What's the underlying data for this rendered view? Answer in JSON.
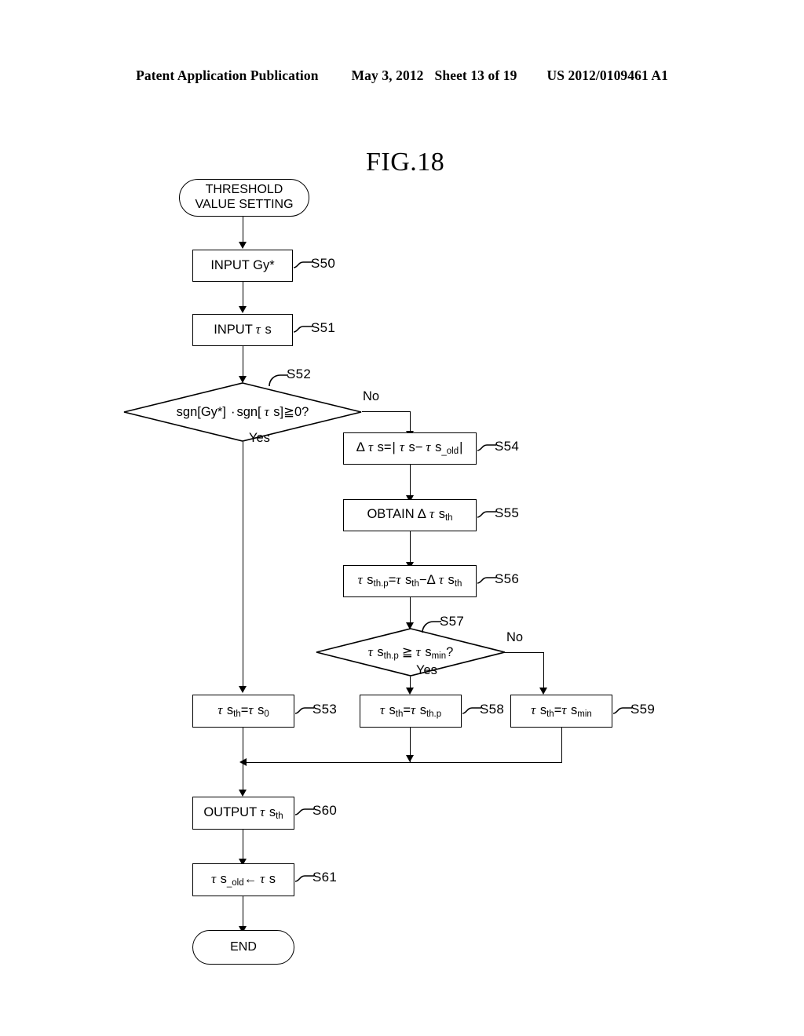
{
  "header": {
    "publication": "Patent Application Publication",
    "date": "May 3, 2012",
    "sheet": "Sheet 13 of 19",
    "docnum": "US 2012/0109461 A1"
  },
  "figure": {
    "title": "FIG.18"
  },
  "flowchart": {
    "type": "flowchart",
    "start": {
      "id": "start",
      "shape": "terminator",
      "line1": "THRESHOLD",
      "line2": "VALUE SETTING"
    },
    "end": {
      "id": "end",
      "shape": "terminator",
      "label": "END"
    },
    "nodes": [
      {
        "id": "S50",
        "shape": "process",
        "text": "INPUT Gy*",
        "step": "S50"
      },
      {
        "id": "S51",
        "shape": "process",
        "text": "INPUT τ s",
        "step": "S51"
      },
      {
        "id": "S52",
        "shape": "decision",
        "text": "sgn[Gy*]·sgn[ τ s]≧0?",
        "step": "S52"
      },
      {
        "id": "S54",
        "shape": "process",
        "text": "Δ τ s=| τ s− τ s_old|",
        "step": "S54"
      },
      {
        "id": "S55",
        "shape": "process",
        "text": "OBTAIN Δ τ s_th",
        "step": "S55"
      },
      {
        "id": "S56",
        "shape": "process",
        "text": "τ s_th.p= τ s_th− Δ τ s_th",
        "step": "S56"
      },
      {
        "id": "S57",
        "shape": "decision",
        "text": "τ s_th.p ≧ τ s_min?",
        "step": "S57"
      },
      {
        "id": "S53",
        "shape": "process",
        "text": "τ s_th= τ s_0",
        "step": "S53"
      },
      {
        "id": "S58",
        "shape": "process",
        "text": "τ s_th= τ s_th.p",
        "step": "S58"
      },
      {
        "id": "S59",
        "shape": "process",
        "text": "τ s_th= τ s_min",
        "step": "S59"
      },
      {
        "id": "S60",
        "shape": "process",
        "text": "OUTPUT τ s_th",
        "step": "S60"
      },
      {
        "id": "S61",
        "shape": "process",
        "text": "τ s_old ← τ s",
        "step": "S61"
      }
    ],
    "branch_labels": {
      "s52_no": "No",
      "s52_yes": "Yes",
      "s57_no": "No",
      "s57_yes": "Yes"
    },
    "steps": {
      "s50": "S50",
      "s51": "S51",
      "s52": "S52",
      "s53": "S53",
      "s54": "S54",
      "s55": "S55",
      "s56": "S56",
      "s57": "S57",
      "s58": "S58",
      "s59": "S59",
      "s60": "S60",
      "s61": "S61"
    },
    "colors": {
      "stroke": "#000000",
      "background": "#ffffff"
    }
  }
}
